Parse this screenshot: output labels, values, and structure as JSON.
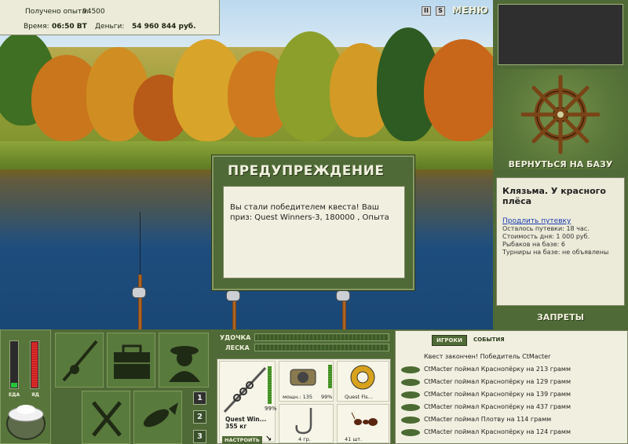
{
  "header": {
    "experience_label": "Получено опыта:",
    "experience_value": "94500",
    "time_label": "Время:",
    "time_value": "06:50 ВТ",
    "money_label": "Деньги:",
    "money_value": "54 960 844 руб.",
    "icon_pause": "II",
    "icon_s": "S",
    "menu": "МЕНЮ"
  },
  "right_panel": {
    "back_to_base": "ВЕРНУТЬСЯ НА БАЗУ",
    "location_title": "Клязьма. У красного плёса",
    "extend_link": "Продлить путевку",
    "rows": [
      "Осталось путевки: 18 час.",
      "Стоимость дня: 1 000 руб.",
      "Рыбаков на базе: 6",
      "Турниры на базе: не объявлены"
    ],
    "bans": "ЗАПРЕТЫ"
  },
  "dialog": {
    "title": "ПРЕДУПРЕЖДЕНИЕ",
    "message": "Вы стали победителем квеста! Ваш приз: Quest Winners-3, 180000 , Опыта"
  },
  "status": {
    "food_label": "ЕДА",
    "poison_label": "ЯД",
    "food_level": 0.1,
    "poison_level": 0.96
  },
  "pages": [
    "1",
    "2",
    "3"
  ],
  "tackle": {
    "rod_label": "УДОЧКА",
    "line_label": "ЛЕСКА",
    "rod_name": "Quest Win...",
    "rod_weight": "355 кг",
    "rod_percent": "99%",
    "configure": "НАСТРОИТЬ",
    "reel_info": "мощн.: 135",
    "reel_percent": "99%",
    "line_name": "Quest Fis...",
    "hook_label": "4 гр.",
    "bait_label": "41 шт."
  },
  "events": {
    "tab_players": "ИГРОКИ",
    "tab_events": "СОБЫТИЯ",
    "header": "Квест закончен! Победитель CtMacter",
    "items": [
      "CtMacter поймал Краснопёрку на 213 грамм",
      "CtMacter поймал Краснопёрку на 129 грамм",
      "CtMacter поймал Краснопёрку на 139 грамм",
      "CtMacter поймал Краснопёрку на 437 грамм",
      "CtMacter поймал Плотву на 114 грамм",
      "CtMacter поймал Краснопёрку на 124 грамм"
    ]
  }
}
